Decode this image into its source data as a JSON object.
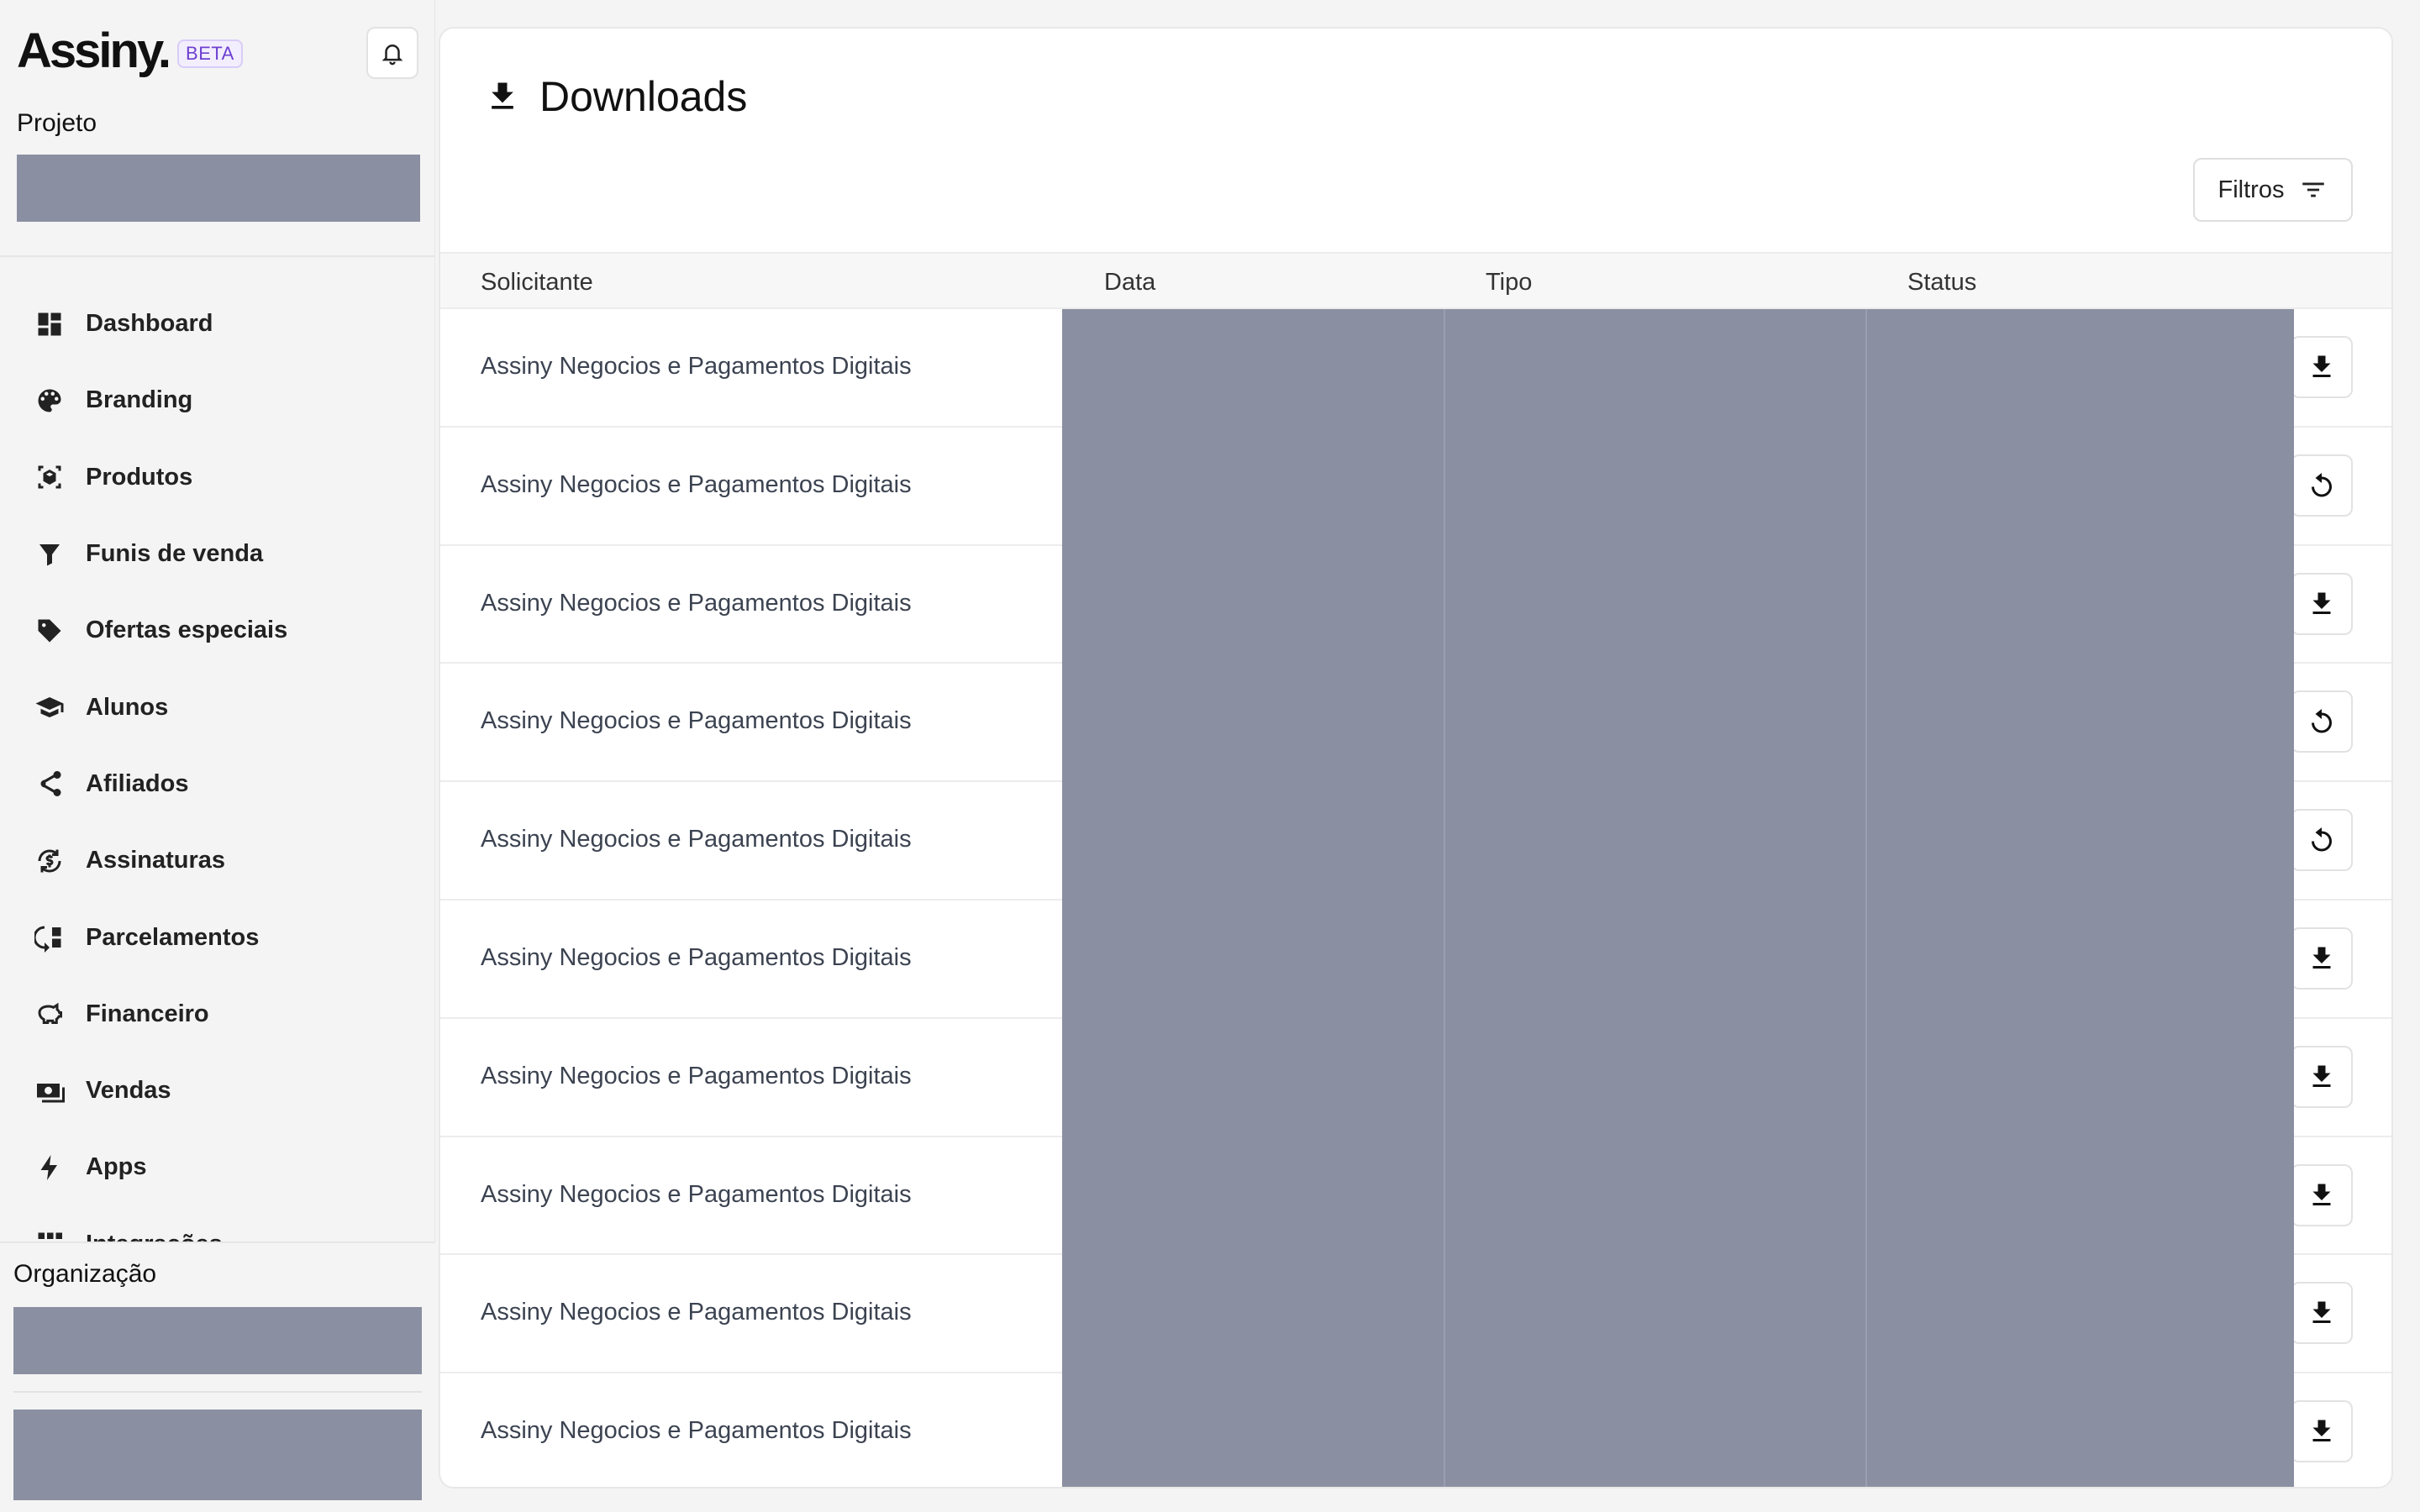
{
  "brand": {
    "logo": "Assiny.",
    "badge": "BETA"
  },
  "sidebar": {
    "project_label": "Projeto",
    "items": [
      {
        "label": "Dashboard",
        "icon": "dashboard-icon"
      },
      {
        "label": "Branding",
        "icon": "palette-icon"
      },
      {
        "label": "Produtos",
        "icon": "package-icon"
      },
      {
        "label": "Funis de venda",
        "icon": "funnel-icon"
      },
      {
        "label": "Ofertas especiais",
        "icon": "tag-icon"
      },
      {
        "label": "Alunos",
        "icon": "graduation-cap-icon"
      },
      {
        "label": "Afiliados",
        "icon": "share-icon"
      },
      {
        "label": "Assinaturas",
        "icon": "currency-refresh-icon"
      },
      {
        "label": "Parcelamentos",
        "icon": "installments-icon"
      },
      {
        "label": "Financeiro",
        "icon": "piggy-bank-icon"
      },
      {
        "label": "Vendas",
        "icon": "cash-icon"
      },
      {
        "label": "Apps",
        "icon": "bolt-icon"
      },
      {
        "label": "Integrações",
        "icon": "grid-icon"
      }
    ],
    "organization_label": "Organização"
  },
  "main": {
    "title": "Downloads",
    "filter_label": "Filtros",
    "columns": [
      "Solicitante",
      "Data",
      "Tipo",
      "Status"
    ],
    "rows": [
      {
        "requester": "Assiny Negocios e Pagamentos Digitais",
        "action": "download"
      },
      {
        "requester": "Assiny Negocios e Pagamentos Digitais",
        "action": "retry"
      },
      {
        "requester": "Assiny Negocios e Pagamentos Digitais",
        "action": "download"
      },
      {
        "requester": "Assiny Negocios e Pagamentos Digitais",
        "action": "retry"
      },
      {
        "requester": "Assiny Negocios e Pagamentos Digitais",
        "action": "retry"
      },
      {
        "requester": "Assiny Negocios e Pagamentos Digitais",
        "action": "download"
      },
      {
        "requester": "Assiny Negocios e Pagamentos Digitais",
        "action": "download"
      },
      {
        "requester": "Assiny Negocios e Pagamentos Digitais",
        "action": "download"
      },
      {
        "requester": "Assiny Negocios e Pagamentos Digitais",
        "action": "download"
      },
      {
        "requester": "Assiny Negocios e Pagamentos Digitais",
        "action": "download"
      }
    ]
  },
  "colors": {
    "redaction": "#8b8fa2",
    "beta_text": "#6c3fd0",
    "beta_bg": "#f3eefe"
  }
}
